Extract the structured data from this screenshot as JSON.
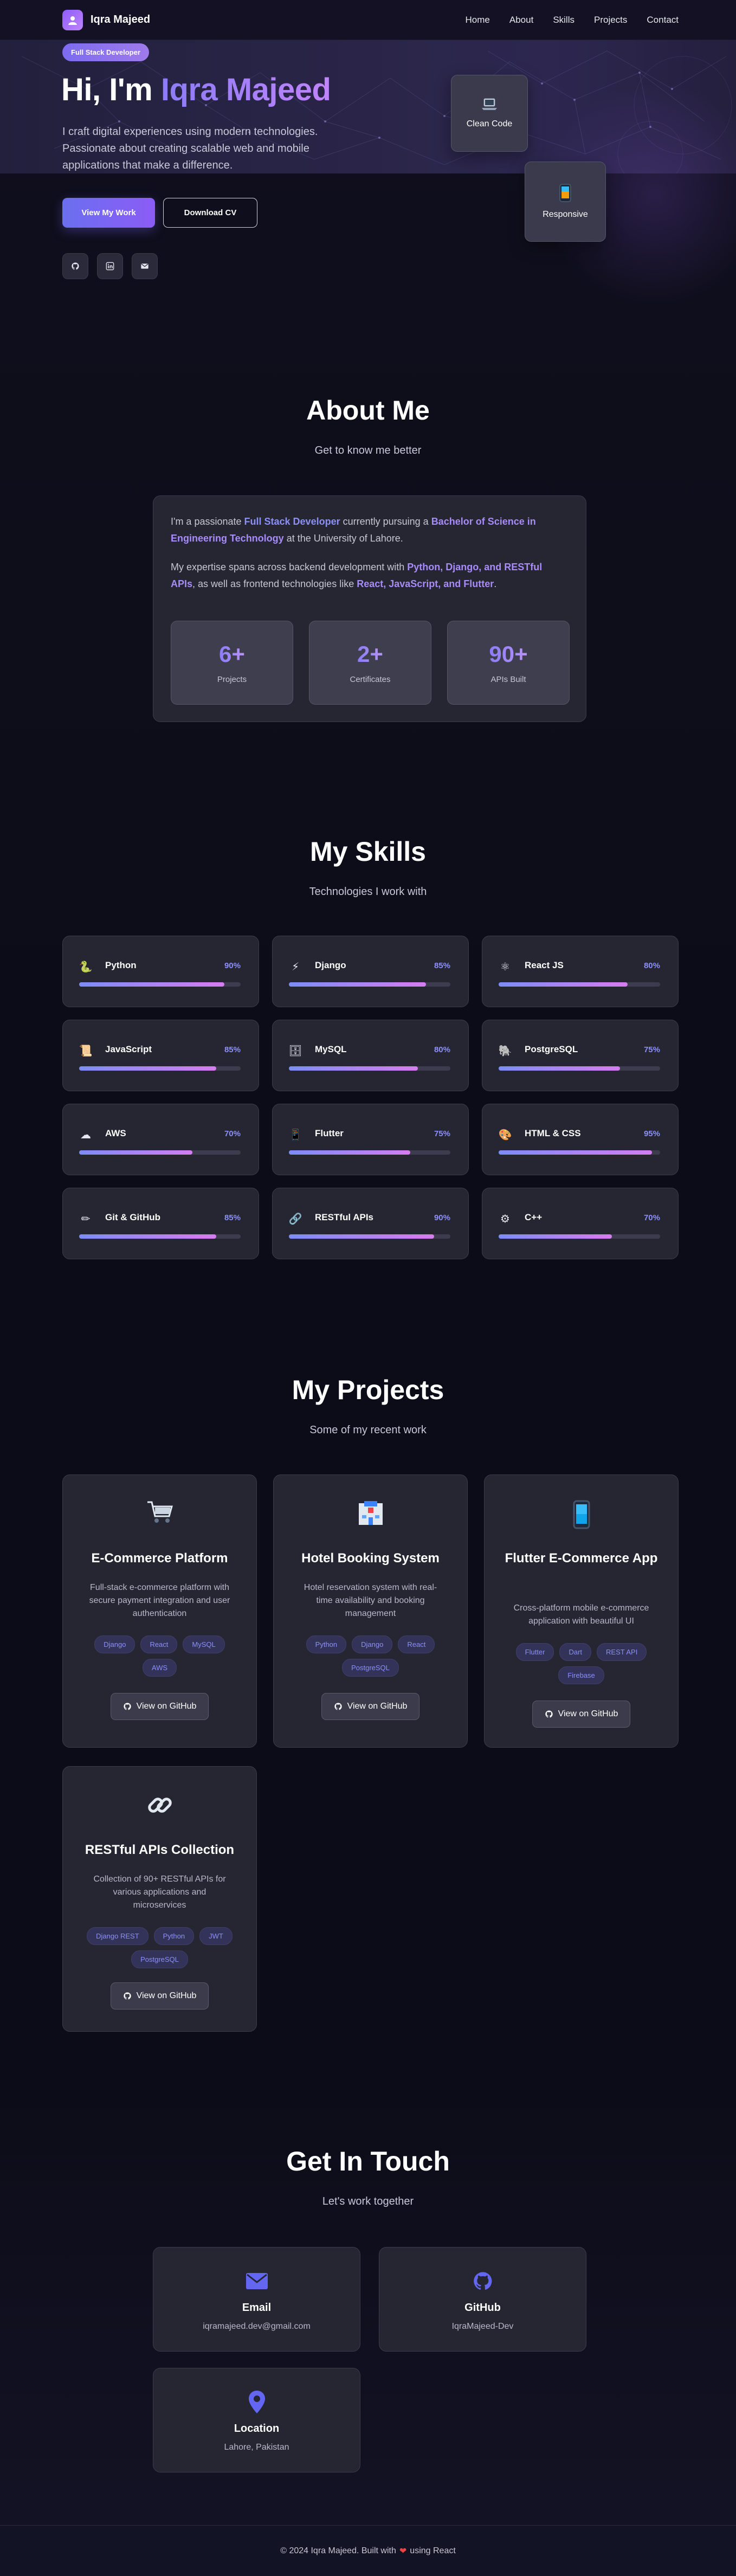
{
  "nav": {
    "brand": "Iqra Majeed",
    "links": [
      "Home",
      "About",
      "Skills",
      "Projects",
      "Contact"
    ]
  },
  "hero": {
    "badge": "Full Stack Developer",
    "greeting": "Hi, I'm ",
    "name": "Iqra Majeed",
    "description": "I craft digital experiences using modern technologies. Passionate about creating scalable web and mobile applications that make a difference.",
    "primary_button": "View My Work",
    "secondary_button": "Download CV",
    "float_cards": [
      "Clean Code",
      "Responsive"
    ],
    "socials": [
      "github-icon",
      "linkedin-icon",
      "mail-icon"
    ]
  },
  "about": {
    "title": "About Me",
    "subtitle": "Get to know me better",
    "p1_a": "I'm a passionate ",
    "p1_b": "Full Stack Developer",
    "p1_c": " currently pursuing a ",
    "p1_d": "Bachelor of Science in Engineering Technology",
    "p1_e": " at the University of Lahore.",
    "p2_a": "My expertise spans across backend development with ",
    "p2_b": "Python, Django, and RESTful APIs",
    "p2_c": ", as well as frontend technologies like ",
    "p2_d": "React, JavaScript, and Flutter",
    "p2_e": ".",
    "stats": [
      {
        "value": "6+",
        "label": "Projects"
      },
      {
        "value": "2+",
        "label": "Certificates"
      },
      {
        "value": "90+",
        "label": "APIs Built"
      }
    ]
  },
  "skills": {
    "title": "My Skills",
    "subtitle": "Technologies I work with",
    "items": [
      {
        "name": "Python",
        "pct": "90%",
        "level": 0.9,
        "icon": "snake-icon"
      },
      {
        "name": "Django",
        "pct": "85%",
        "level": 0.85,
        "icon": "lightning-icon"
      },
      {
        "name": "React JS",
        "pct": "80%",
        "level": 0.8,
        "icon": "atom-icon"
      },
      {
        "name": "JavaScript",
        "pct": "85%",
        "level": 0.85,
        "icon": "scroll-icon"
      },
      {
        "name": "MySQL",
        "pct": "80%",
        "level": 0.8,
        "icon": "database-icon"
      },
      {
        "name": "PostgreSQL",
        "pct": "75%",
        "level": 0.75,
        "icon": "elephant-icon"
      },
      {
        "name": "AWS",
        "pct": "70%",
        "level": 0.7,
        "icon": "cloud-icon"
      },
      {
        "name": "Flutter",
        "pct": "75%",
        "level": 0.75,
        "icon": "phone-icon"
      },
      {
        "name": "HTML & CSS",
        "pct": "95%",
        "level": 0.95,
        "icon": "palette-icon"
      },
      {
        "name": "Git & GitHub",
        "pct": "85%",
        "level": 0.85,
        "icon": "pen-icon"
      },
      {
        "name": "RESTful APIs",
        "pct": "90%",
        "level": 0.9,
        "icon": "link-icon"
      },
      {
        "name": "C++",
        "pct": "70%",
        "level": 0.7,
        "icon": "gear-icon"
      }
    ]
  },
  "projects": {
    "title": "My Projects",
    "subtitle": "Some of my recent work",
    "button": "View on GitHub",
    "items": [
      {
        "title": "E-Commerce Platform",
        "desc": "Full-stack e-commerce platform with secure payment integration and user authentication",
        "tags": [
          "Django",
          "React",
          "MySQL",
          "AWS"
        ],
        "icon": "cart-icon"
      },
      {
        "title": "Hotel Booking System",
        "desc": "Hotel reservation system with real-time availability and booking management",
        "tags": [
          "Python",
          "Django",
          "React",
          "PostgreSQL"
        ],
        "icon": "hotel-icon"
      },
      {
        "title": "Flutter E-Commerce App",
        "desc": "Cross-platform mobile e-commerce application with beautiful UI",
        "tags": [
          "Flutter",
          "Dart",
          "REST API",
          "Firebase"
        ],
        "icon": "phone-icon"
      },
      {
        "title": "RESTful APIs Collection",
        "desc": "Collection of 90+ RESTful APIs for various applications and microservices",
        "tags": [
          "Django REST",
          "Python",
          "JWT",
          "PostgreSQL"
        ],
        "icon": "link-icon"
      }
    ]
  },
  "contact": {
    "title": "Get In Touch",
    "subtitle": "Let's work together",
    "items": [
      {
        "title": "Email",
        "value": "iqramajeed.dev@gmail.com",
        "icon": "envelope-icon"
      },
      {
        "title": "GitHub",
        "value": "IqraMajeed-Dev",
        "icon": "github-icon"
      },
      {
        "title": "Location",
        "value": "Lahore, Pakistan",
        "icon": "location-pin-icon"
      }
    ]
  },
  "footer": {
    "text_a": "© 2024 Iqra Majeed. Built with",
    "text_b": "using React"
  },
  "colors": {
    "accent": "#8b8ff8",
    "accent_purple": "#a78bfa",
    "card_bg": "#262633",
    "page_bg": "#0c0c18"
  }
}
